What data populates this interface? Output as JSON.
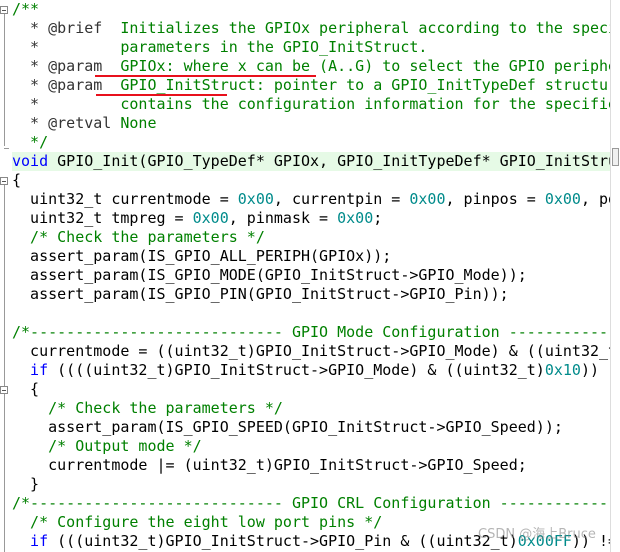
{
  "colors": {
    "comment": "#008000",
    "keyword": "#0000ff",
    "number": "#008b8b",
    "highlight_line": "#e6fae6",
    "annotation_underline": "#e8101c"
  },
  "highlighted_line": 8,
  "watermark": "CSDN @海上Bruce",
  "lines": [
    [
      [
        "c",
        "/**"
      ]
    ],
    [
      [
        "d",
        "  * @brief  "
      ],
      [
        "c",
        "Initializes the GPIOx peripheral according to the speci"
      ]
    ],
    [
      [
        "d",
        "  *         "
      ],
      [
        "c",
        "parameters in the GPIO_InitStruct."
      ]
    ],
    [
      [
        "d",
        "  * @param  "
      ],
      [
        "c",
        "GPIOx: where x can be (A..G) to select the GPIO periphe"
      ]
    ],
    [
      [
        "d",
        "  * @param  "
      ],
      [
        "c",
        "GPIO_InitStruct: pointer to a GPIO_InitTypeDef structur"
      ]
    ],
    [
      [
        "d",
        "  *         "
      ],
      [
        "c",
        "contains the configuration information for the specifie"
      ]
    ],
    [
      [
        "d",
        "  * @retval "
      ],
      [
        "c",
        "None"
      ]
    ],
    [
      [
        "c",
        "  */"
      ]
    ],
    [
      [
        "k",
        "void"
      ],
      [
        "p",
        " GPIO_Init(GPIO_TypeDef* GPIOx, GPIO_InitTypeDef* GPIO_InitStru"
      ]
    ],
    [
      [
        "p",
        "{"
      ]
    ],
    [
      [
        "p",
        "  uint32_t currentmode = "
      ],
      [
        "n",
        "0x00"
      ],
      [
        "p",
        ", currentpin = "
      ],
      [
        "n",
        "0x00"
      ],
      [
        "p",
        ", pinpos = "
      ],
      [
        "n",
        "0x00"
      ],
      [
        "p",
        ", po"
      ]
    ],
    [
      [
        "p",
        "  uint32_t tmpreg = "
      ],
      [
        "n",
        "0x00"
      ],
      [
        "p",
        ", pinmask = "
      ],
      [
        "n",
        "0x00"
      ],
      [
        "p",
        ";"
      ]
    ],
    [
      [
        "c",
        "  /* Check the parameters */"
      ]
    ],
    [
      [
        "p",
        "  assert_param(IS_GPIO_ALL_PERIPH(GPIOx));"
      ]
    ],
    [
      [
        "p",
        "  assert_param(IS_GPIO_MODE(GPIO_InitStruct->GPIO_Mode));"
      ]
    ],
    [
      [
        "p",
        "  assert_param(IS_GPIO_PIN(GPIO_InitStruct->GPIO_Pin));"
      ]
    ],
    [
      [
        "p",
        ""
      ]
    ],
    [
      [
        "c",
        "/*---------------------------- GPIO Mode Configuration -------------"
      ]
    ],
    [
      [
        "p",
        "  currentmode = ((uint32_t)GPIO_InitStruct->GPIO_Mode) & ((uint32_t"
      ]
    ],
    [
      [
        "k",
        "  if"
      ],
      [
        "p",
        " ((((uint32_t)GPIO_InitStruct->GPIO_Mode) & ((uint32_t)"
      ],
      [
        "n",
        "0x10"
      ],
      [
        "p",
        "))"
      ]
    ],
    [
      [
        "p",
        "  {"
      ]
    ],
    [
      [
        "c",
        "    /* Check the parameters */"
      ]
    ],
    [
      [
        "p",
        "    assert_param(IS_GPIO_SPEED(GPIO_InitStruct->GPIO_Speed));"
      ]
    ],
    [
      [
        "c",
        "    /* Output mode */"
      ]
    ],
    [
      [
        "p",
        "    currentmode |= (uint32_t)GPIO_InitStruct->GPIO_Speed;"
      ]
    ],
    [
      [
        "p",
        "  }"
      ]
    ],
    [
      [
        "c",
        "/*---------------------------- GPIO CRL Configuration --------------"
      ]
    ],
    [
      [
        "c",
        "  /* Configure the eight low port pins */"
      ]
    ],
    [
      [
        "k",
        "  if"
      ],
      [
        "p",
        " (((uint32_t)GPIO_InitStruct->GPIO_Pin & ((uint32_t)"
      ],
      [
        "n",
        "0x00FF"
      ],
      [
        "p",
        ")) !="
      ]
    ]
  ]
}
